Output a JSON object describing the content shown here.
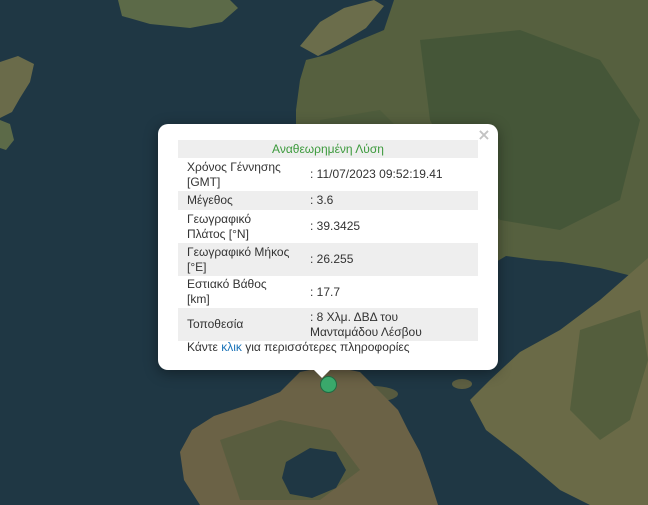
{
  "popup": {
    "title": "Αναθεωρημένη Λύση",
    "close_glyph": "×",
    "rows": [
      {
        "label": "Χρόνος Γέννησης [GMT]",
        "value": ": 11/07/2023 09:52:19.41"
      },
      {
        "label": "Μέγεθος",
        "value": ": 3.6"
      },
      {
        "label": "Γεωγραφικό Πλάτος [°N]",
        "value": ": 39.3425"
      },
      {
        "label": "Γεωγραφικό Μήκος [°E]",
        "value": ": 26.255"
      },
      {
        "label": "Εστιακό Βάθος [km]",
        "value": ": 17.7"
      },
      {
        "label": "Τοποθεσία",
        "value": ": 8 Χλμ. ΔΒΔ του Μανταμάδου Λέσβου"
      }
    ],
    "footer_prefix": "Κάντε ",
    "footer_link": "κλικ",
    "footer_suffix": " για περισσότερες πληροφορίες"
  },
  "colors": {
    "sea": "#1d3440",
    "land": "#5b5f3d",
    "title_text": "#3c9a3c",
    "link": "#1a73b8",
    "marker": "#3aa86b"
  },
  "icons": {
    "close": "close-icon",
    "marker": "earthquake-marker"
  }
}
